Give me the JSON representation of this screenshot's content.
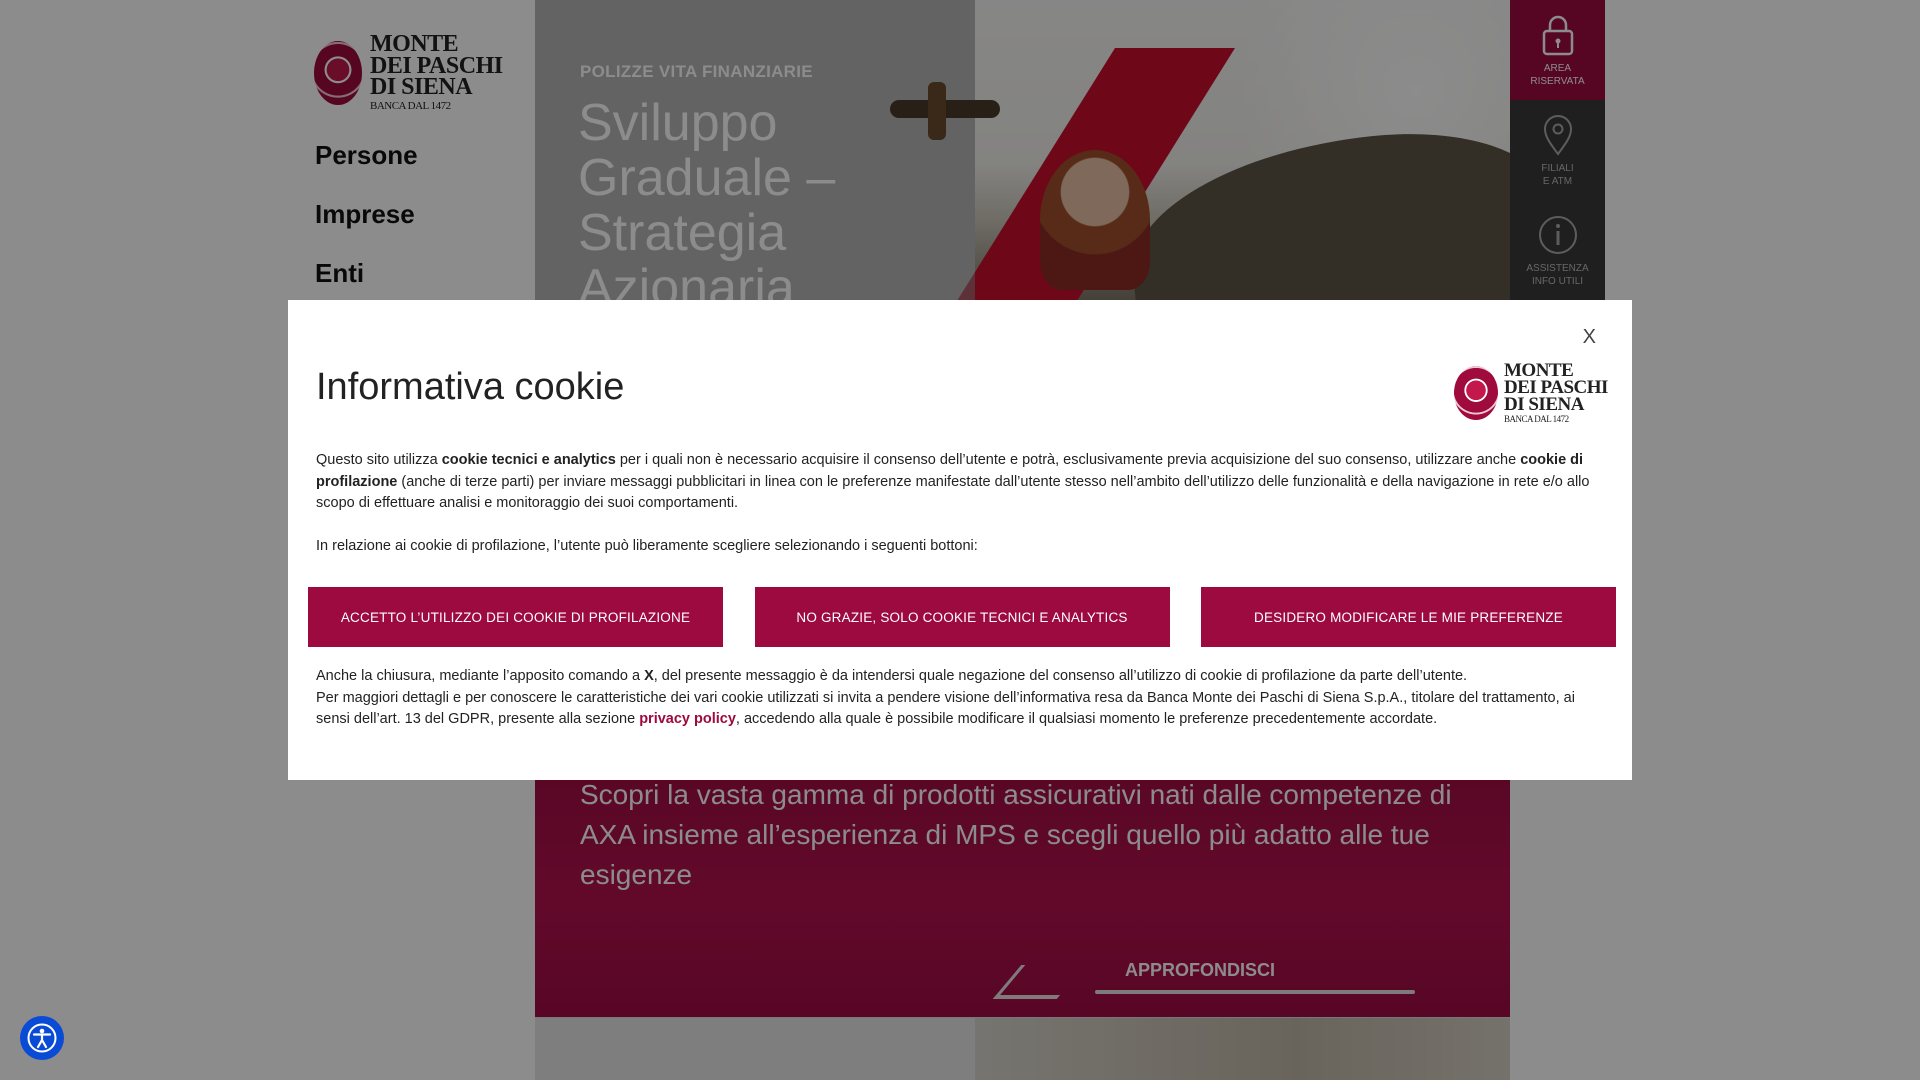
{
  "brand": {
    "line1": "MONTE",
    "line2": "DEI PASCHI",
    "line3": "DI SIENA",
    "tagline": "BANCA DAL 1472",
    "accent_color": "#9d0a40"
  },
  "nav": {
    "items": [
      {
        "label": "Persone"
      },
      {
        "label": "Imprese"
      },
      {
        "label": "Enti"
      }
    ]
  },
  "hero": {
    "kicker": "POLIZZE VITA FINANZIARIE",
    "title": "Sviluppo Graduale – Strategia Azionaria"
  },
  "sidebar": {
    "items": [
      {
        "line1": "AREA",
        "line2": "RISERVATA",
        "icon": "lock-icon"
      },
      {
        "line1": "FILIALI",
        "line2": "E ATM",
        "icon": "map-pin-icon"
      },
      {
        "line1": "ASSISTENZA",
        "line2": "INFO UTILI",
        "icon": "info-icon"
      }
    ]
  },
  "promo": {
    "text": "Scopri la vasta gamma di prodotti assicurativi nati dalle competenze di AXA insieme all’esperienza di MPS e scegli quello più adatto alle tue esigenze",
    "link_label": "APPROFONDISCI"
  },
  "cookie_modal": {
    "close_label": "X",
    "title": "Informativa cookie",
    "p1_a": "Questo sito utilizza ",
    "p1_b": "cookie tecnici e analytics",
    "p1_c": " per i quali non è necessario acquisire il consenso dell’utente e potrà, esclusivamente previa acquisizione del suo consenso, utilizzare anche ",
    "p1_d": "cookie di profilazione",
    "p1_e": " (anche di terze parti) per inviare messaggi pubblicitari in linea con le preferenze manifestate dall’utente stesso nell’ambito dell’utilizzo delle funzionalità e della navigazione in rete e/o allo scopo di effettuare analisi e monitoraggio dei suoi comportamenti.",
    "p2": "In relazione ai cookie di profilazione, l’utente può liberamente scegliere selezionando i seguenti bottoni:",
    "buttons": [
      {
        "label": "ACCETTO L’UTILIZZO DEI COOKIE DI PROFILAZIONE"
      },
      {
        "label": "NO GRAZIE, SOLO COOKIE TECNICI E ANALYTICS"
      },
      {
        "label": "DESIDERO MODIFICARE LE MIE PREFERENZE"
      }
    ],
    "f1_a": "Anche la chiusura, mediante l’apposito comando a ",
    "f1_b": "X",
    "f1_c": ", del presente messaggio è da intendersi quale negazione del consenso all’utilizzo di cookie di profilazione da parte dell’utente.",
    "f2_a": "Per maggiori dettagli e per conoscere le caratteristiche dei vari cookie utilizzati si invita a pendere visione dell’informativa resa da Banca Monte dei Paschi di Siena S.p.A., titolare del trattamento, ai sensi dell’art. 13 del GDPR, presente alla sezione ",
    "f2_link": "privacy policy",
    "f2_b": ", accedendo alla quale è possibile modificare il qualsiasi momento le preferenze precedentemente accordate."
  },
  "accessibility": {
    "icon": "accessibility-icon",
    "color": "#0a4bd6"
  }
}
